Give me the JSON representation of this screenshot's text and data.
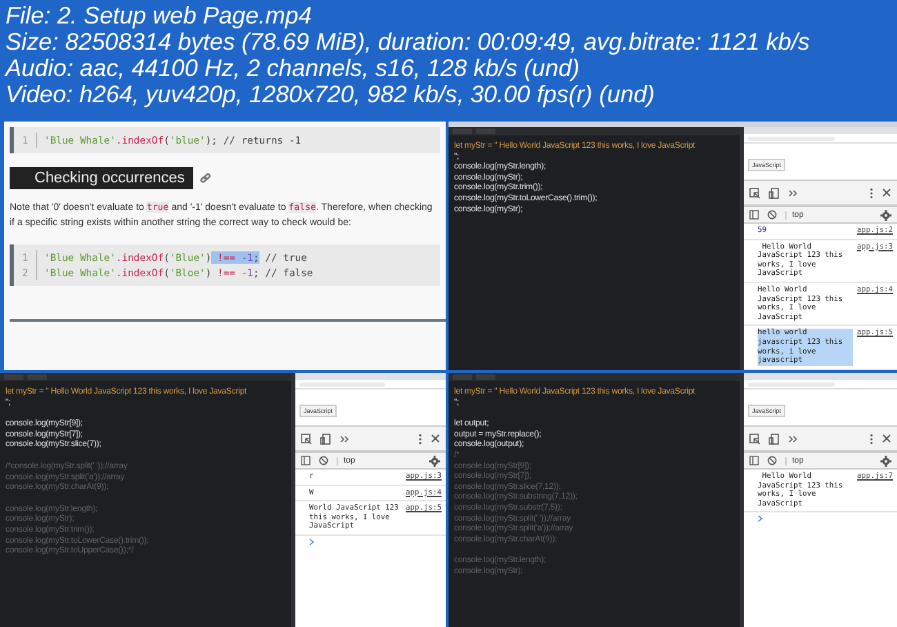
{
  "header": {
    "lines": [
      "File: 2. Setup web Page.mp4",
      "Size: 82508314 bytes (78.69 MiB), duration: 00:09:49, avg.bitrate: 1121 kb/s",
      "Audio: aac, 44100 Hz, 2 channels, s16, 128 kb/s (und)",
      "Video: h264, yuv420p, 1280x720, 982 kb/s, 30.00 fps(r) (und)"
    ]
  },
  "frames": [
    {
      "kind": "article",
      "code_blocks": [
        {
          "lines": [
            {
              "number": "1",
              "parts": [
                {
                  "text": "'Blue Whale'",
                  "kind": "string",
                  "selected": false
                },
                {
                  "text": ".indexOf",
                  "kind": "method",
                  "selected": false
                },
                {
                  "text": "(",
                  "kind": "plain",
                  "selected": false
                },
                {
                  "text": "'blue'",
                  "kind": "string",
                  "selected": false
                },
                {
                  "text": "); // returns -1",
                  "kind": "plain",
                  "selected": false
                }
              ]
            }
          ]
        },
        {
          "lines": [
            {
              "number": "1",
              "parts": [
                {
                  "text": "'Blue Whale'",
                  "kind": "string",
                  "selected": false
                },
                {
                  "text": ".indexOf",
                  "kind": "method",
                  "selected": false
                },
                {
                  "text": "(",
                  "kind": "plain",
                  "selected": false
                },
                {
                  "text": "'Blue'",
                  "kind": "string",
                  "selected": false
                },
                {
                  "text": ")",
                  "kind": "plain",
                  "selected": false
                },
                {
                  "text": " !== ",
                  "kind": "method",
                  "selected": true
                },
                {
                  "text": "-1",
                  "kind": "number",
                  "selected": true
                },
                {
                  "text": ";",
                  "kind": "plain",
                  "selected": true
                },
                {
                  "text": " // true",
                  "kind": "plain",
                  "selected": false
                }
              ]
            },
            {
              "number": "2",
              "parts": [
                {
                  "text": "'Blue Whale'",
                  "kind": "string",
                  "selected": false
                },
                {
                  "text": ".indexOf",
                  "kind": "method",
                  "selected": false
                },
                {
                  "text": "(",
                  "kind": "plain",
                  "selected": false
                },
                {
                  "text": "'Bloe'",
                  "kind": "string",
                  "selected": false
                },
                {
                  "text": ")",
                  "kind": "plain",
                  "selected": false
                },
                {
                  "text": " !== ",
                  "kind": "method",
                  "selected": false
                },
                {
                  "text": "-1",
                  "kind": "number",
                  "selected": false
                },
                {
                  "text": "; // false",
                  "kind": "plain",
                  "selected": false
                }
              ]
            }
          ]
        }
      ],
      "heading": "Checking occurrences",
      "paragraph": [
        {
          "text": "Note that '0' doesn't evaluate to ",
          "kind": "text"
        },
        {
          "text": "true",
          "kind": "code"
        },
        {
          "text": " and '-1' doesn't evaluate to ",
          "kind": "text"
        },
        {
          "text": "false",
          "kind": "code"
        },
        {
          "text": ". Therefore, when checking if a specific string exists within another string the correct way to check would be:",
          "kind": "text"
        }
      ]
    },
    {
      "kind": "ide",
      "menubar": true,
      "editor_blocks": [
        [
          {
            "text": "let myStr = \" Hello World JavaScript 123 this works, I love JavaScript",
            "kind": "code"
          },
          {
            "text": "\";",
            "kind": "code"
          },
          {
            "text": "console.log(myStr.length);",
            "kind": "code"
          },
          {
            "text": "console.log(myStr);",
            "kind": "code"
          },
          {
            "text": "console.log(myStr.trim());",
            "kind": "code"
          },
          {
            "text": "console.log(myStr.toLowerCase().trim());",
            "kind": "code"
          },
          {
            "text": "console.log(myStr);",
            "kind": "code"
          }
        ]
      ],
      "page_button": "JavaScript",
      "context": "top",
      "console": [
        {
          "message": "59",
          "kind": "number",
          "source": "app.js:2",
          "selected": false
        },
        {
          "message": " Hello World JavaScript 123 this works, I love JavaScript",
          "kind": "string",
          "source": "app.js:3",
          "selected": false
        },
        {
          "message": "Hello World JavaScript 123 this works, I love JavaScript",
          "kind": "string",
          "source": "app.js:4",
          "selected": false
        },
        {
          "message": "hello world javascript 123 this works, i love javascript",
          "kind": "string",
          "source": "app.js:5",
          "selected": true
        }
      ]
    },
    {
      "kind": "ide",
      "menubar": false,
      "editor_blocks": [
        [
          {
            "text": "let myStr = \" Hello World JavaScript 123 this works, I love JavaScript",
            "kind": "code"
          },
          {
            "text": "\";",
            "kind": "code"
          }
        ],
        [
          {
            "text": "console.log(myStr[9]);",
            "kind": "code"
          },
          {
            "text": "console.log(myStr[7]);",
            "kind": "code"
          },
          {
            "text": "console.log(myStr.slice(7));",
            "kind": "code"
          }
        ],
        [
          {
            "text": "/*console.log(myStr.split(' '));//array",
            "kind": "comment"
          },
          {
            "text": "console.log(myStr.split('a'));//array",
            "kind": "comment"
          },
          {
            "text": "console.log(myStr.charAt(9));",
            "kind": "comment"
          }
        ],
        [
          {
            "text": "console.log(myStr.length);",
            "kind": "comment"
          },
          {
            "text": "console.log(myStr);",
            "kind": "comment"
          },
          {
            "text": "console.log(myStr.trim());",
            "kind": "comment"
          },
          {
            "text": "console.log(myStr.toLowerCase().trim());",
            "kind": "comment"
          },
          {
            "text": "console.log(myStr.toUpperCase());*/",
            "kind": "comment"
          }
        ]
      ],
      "page_button": "JavaScript",
      "context": "top",
      "console": [
        {
          "message": "r",
          "kind": "string",
          "source": "app.js:3",
          "selected": false
        },
        {
          "message": "W",
          "kind": "string",
          "source": "app.js:4",
          "selected": false
        },
        {
          "message": "World JavaScript 123 this works, I love JavaScript",
          "kind": "string",
          "source": "app.js:5",
          "selected": false
        }
      ]
    },
    {
      "kind": "ide",
      "menubar": false,
      "editor_blocks": [
        [
          {
            "text": "let myStr = \" Hello World JavaScript 123 this works, I love JavaScript",
            "kind": "code"
          },
          {
            "text": "\";",
            "kind": "code"
          }
        ],
        [
          {
            "text": "let output;",
            "kind": "code"
          },
          {
            "text": "output = myStr.replace();",
            "kind": "code"
          },
          {
            "text": "console.log(output);",
            "kind": "code"
          },
          {
            "text": "/*",
            "kind": "comment"
          },
          {
            "text": "console.log(myStr[9]);",
            "kind": "comment"
          },
          {
            "text": "console.log(myStr[7]);",
            "kind": "comment"
          },
          {
            "text": "console.log(myStr.slice(7,12));",
            "kind": "comment"
          },
          {
            "text": "console.log(myStr.substring(7,12));",
            "kind": "comment"
          },
          {
            "text": "console.log(myStr.substr(7,5));",
            "kind": "comment"
          },
          {
            "text": "console.log(myStr.split(' '));//array",
            "kind": "comment"
          },
          {
            "text": "console.log(myStr.split('a'));//array",
            "kind": "comment"
          },
          {
            "text": "console.log(myStr.charAt(9));",
            "kind": "comment"
          }
        ],
        [
          {
            "text": "console.log(myStr.length);",
            "kind": "comment"
          },
          {
            "text": "console.log(myStr);",
            "kind": "comment"
          }
        ]
      ],
      "page_button": "JavaScript",
      "context": "top",
      "console": [
        {
          "message": " Hello World JavaScript 123 this works, I love JavaScript",
          "kind": "string",
          "source": "app.js:7",
          "selected": false
        }
      ]
    }
  ]
}
